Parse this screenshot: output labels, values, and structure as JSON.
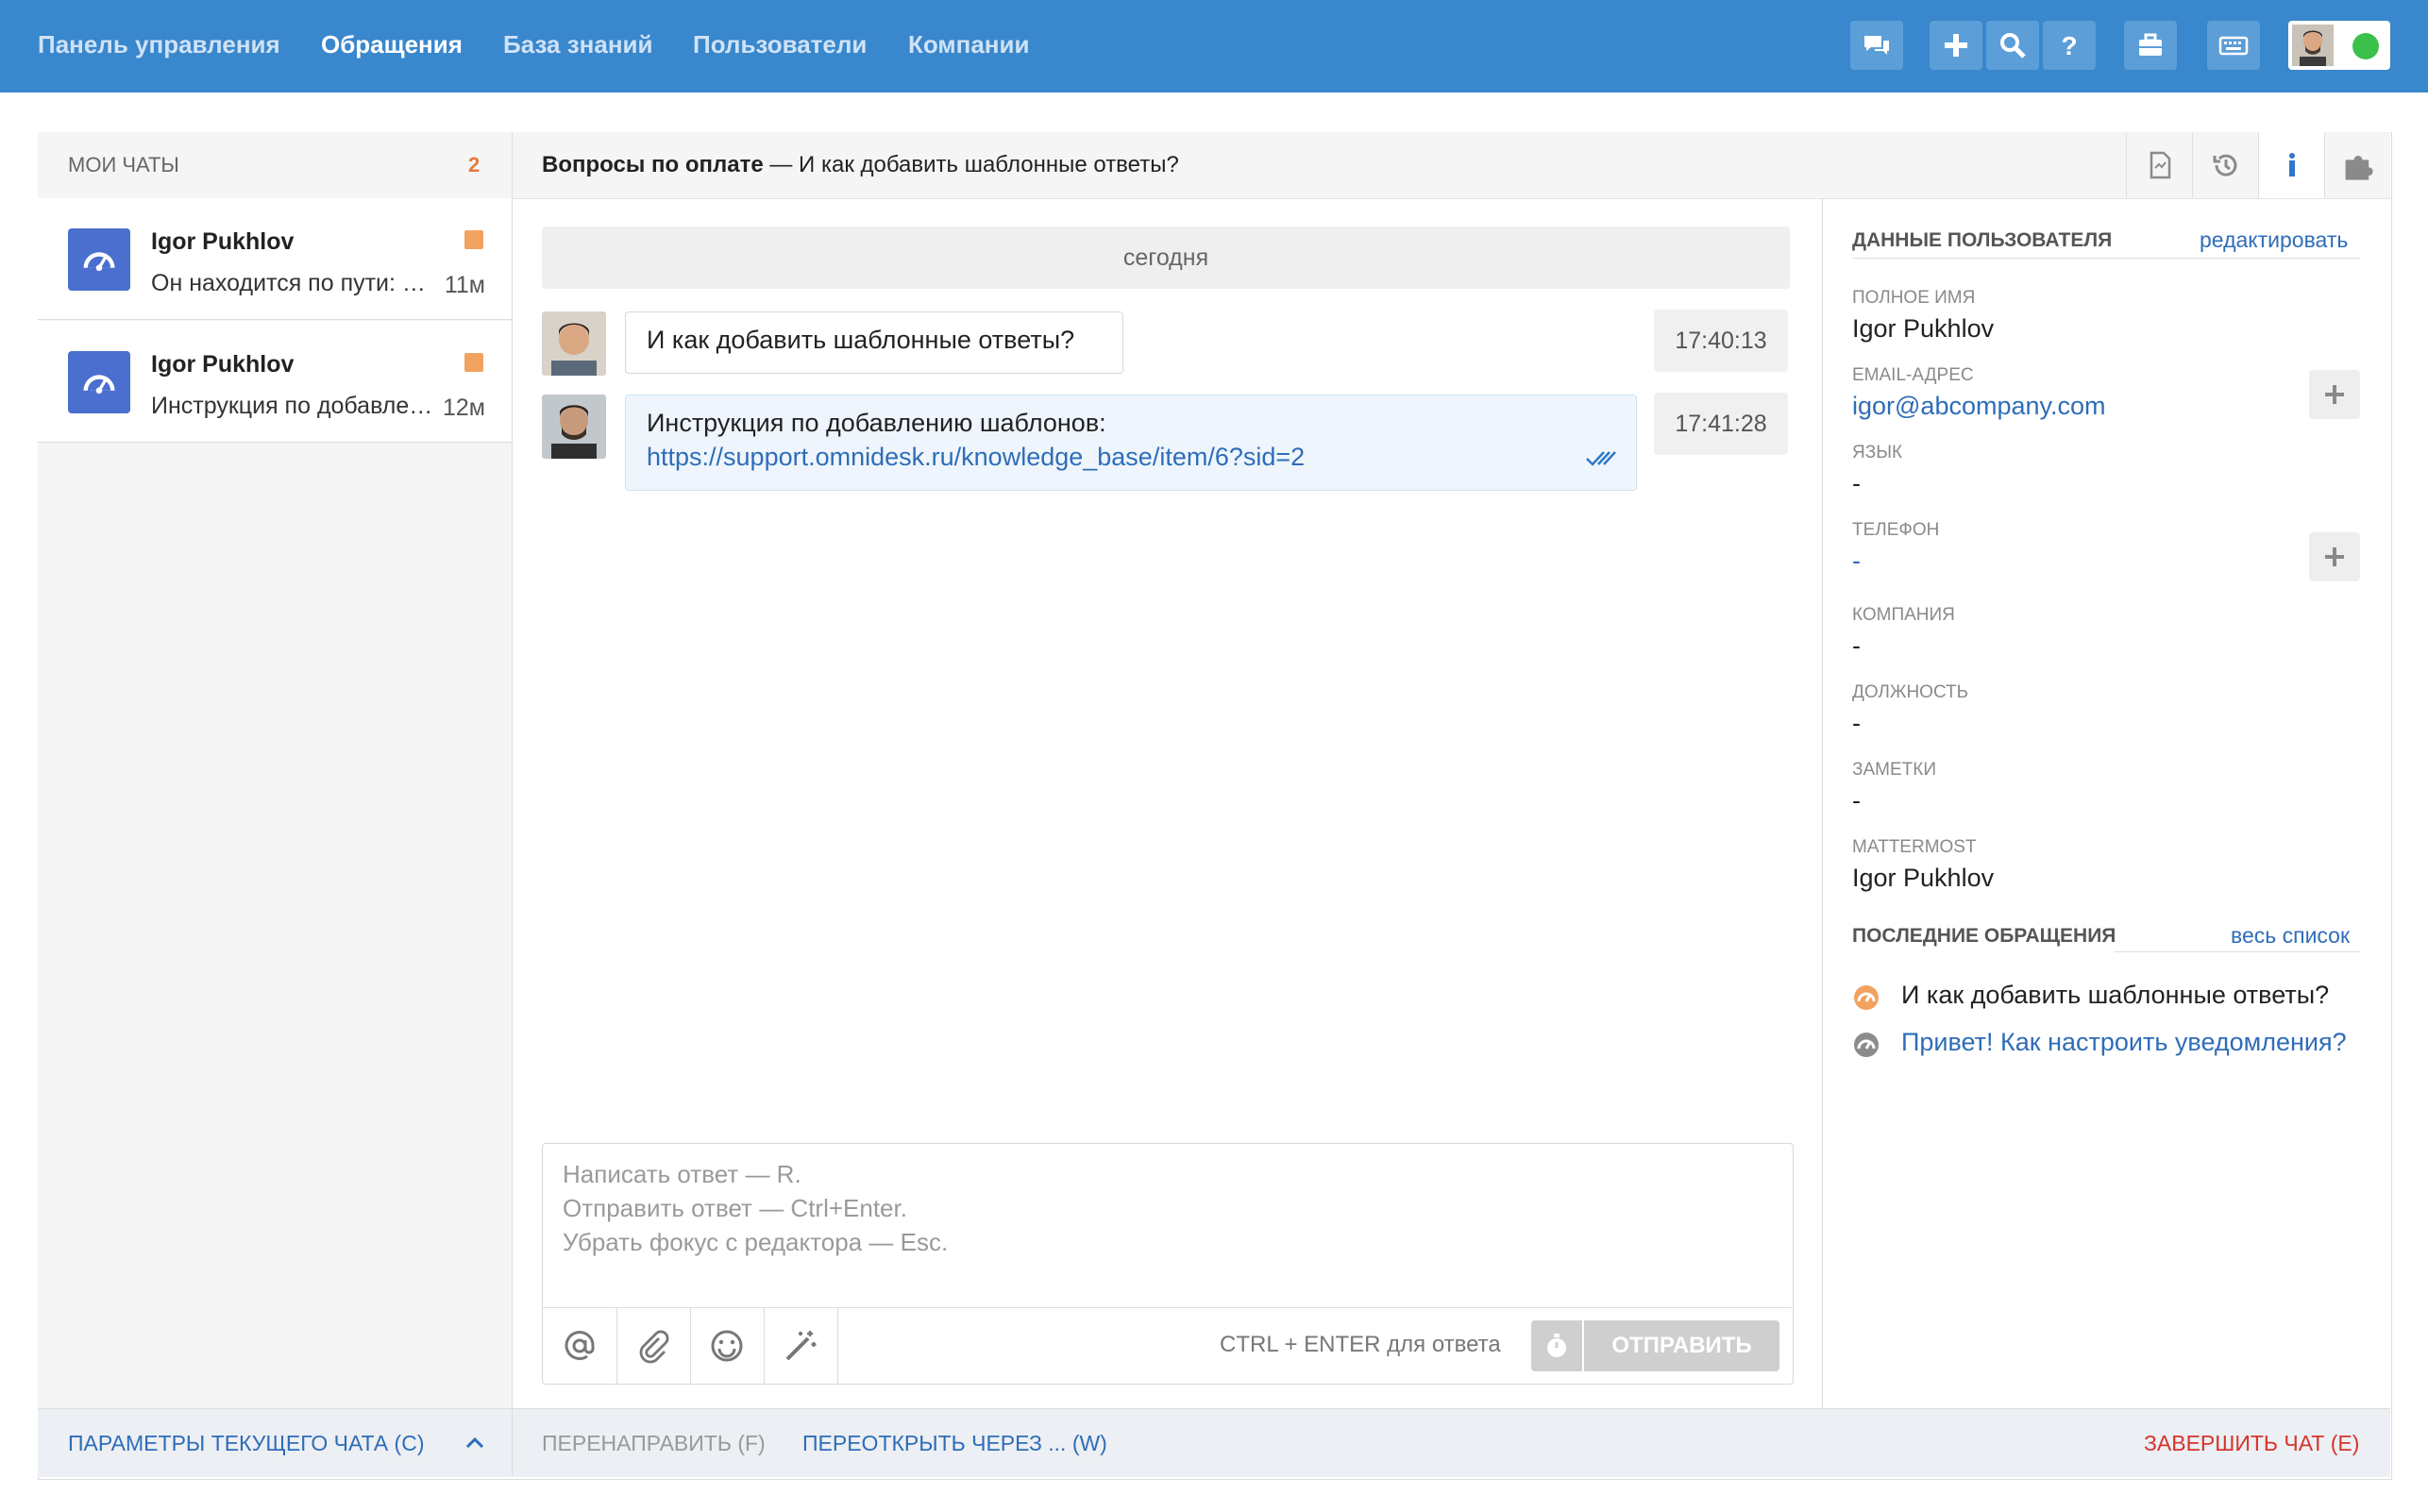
{
  "nav": {
    "items": [
      {
        "label": "Панель управления",
        "active": false
      },
      {
        "label": "Обращения",
        "active": true
      },
      {
        "label": "База знаний",
        "active": false
      },
      {
        "label": "Пользователи",
        "active": false
      },
      {
        "label": "Компании",
        "active": false
      }
    ],
    "tool_icons": [
      "chat-icon",
      "plus-icon",
      "search-icon",
      "help-icon",
      "briefcase-icon",
      "keyboard-icon"
    ],
    "status_color": "#3bc14a",
    "bar_color": "#3987cc"
  },
  "sidebar": {
    "title": "МОИ ЧАТЫ",
    "count": "2",
    "chats": [
      {
        "name": "Igor Pukhlov",
        "preview": "Он находится по пути: Настройки...",
        "time": "11м"
      },
      {
        "name": "Igor Pukhlov",
        "preview": "Инструкция по добавлению шаблонов",
        "time": "12м"
      }
    ],
    "footer_label": "ПАРАМЕТРЫ ТЕКУЩЕГО ЧАТА (C)"
  },
  "conversation": {
    "group": "Вопросы по оплате",
    "separator": "—",
    "subject": "И как добавить шаблонные ответы?",
    "date_label": "сегодня",
    "messages": [
      {
        "text": "И как добавить шаблонные ответы?",
        "time": "17:40:13"
      },
      {
        "text": "Инструкция по добавлению шаблонов:",
        "link": "https://support.omnidesk.ru/knowledge_base/item/6?sid=2",
        "time": "17:41:28"
      }
    ],
    "composer": {
      "placeholder_lines": [
        "Написать ответ — R.",
        "Отправить ответ — Ctrl+Enter.",
        "Убрать фокус с редактора — Esc."
      ],
      "hint": "CTRL + ENTER для ответа",
      "send_label": "ОТПРАВИТЬ"
    }
  },
  "user_info": {
    "section_title": "ДАННЫЕ ПОЛЬЗОВАТЕЛЯ",
    "edit_label": "редактировать",
    "fields": {
      "full_name_label": "ПОЛНОЕ ИМЯ",
      "full_name": "Igor Pukhlov",
      "email_label": "EMAIL-АДРЕС",
      "email": "igor@abcompany.com",
      "language_label": "ЯЗЫК",
      "language": "-",
      "phone_label": "ТЕЛЕФОН",
      "phone": "-",
      "company_label": "КОМПАНИЯ",
      "company": "-",
      "position_label": "ДОЛЖНОСТЬ",
      "position": "-",
      "notes_label": "ЗАМЕТКИ",
      "notes": "-",
      "mattermost_label": "MATTERMOST",
      "mattermost": "Igor Pukhlov"
    },
    "recent_title": "ПОСЛЕДНИЕ ОБРАЩЕНИЯ",
    "recent_all": "весь список",
    "recent": [
      {
        "text": "И как добавить шаблонные ответы?",
        "color": "#f1a25f"
      },
      {
        "text": "Привет! Как настроить уведомления?",
        "color": "#8c8c8c"
      }
    ]
  },
  "footer": {
    "forward": "ПЕРЕНАПРАВИТЬ (F)",
    "reopen": "ПЕРЕОТКРЫТЬ ЧЕРЕЗ ... (W)",
    "finish": "ЗАВЕРШИТЬ ЧАТ (E)"
  }
}
